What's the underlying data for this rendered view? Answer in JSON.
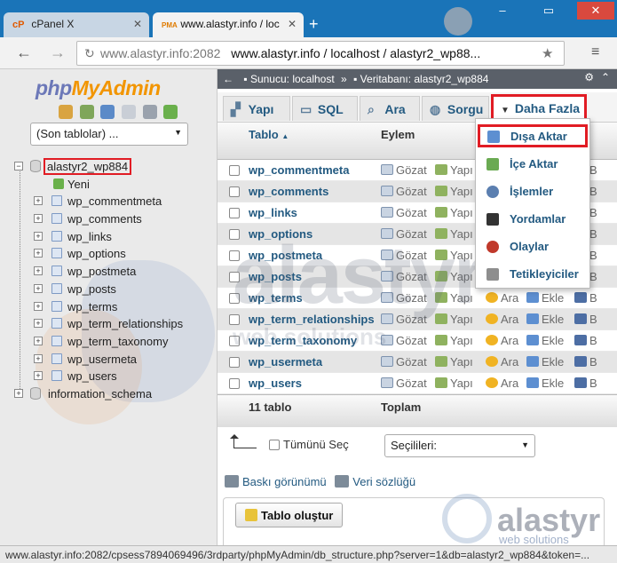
{
  "browser": {
    "tabs": [
      {
        "favicon": "cP",
        "title": "cPanel X"
      },
      {
        "favicon": "PMA",
        "title": "www.alastyr.info / loc"
      }
    ],
    "address": {
      "host": "www.alastyr.info:2082",
      "path": "www.alastyr.info / localhost / alastyr2_wp88..."
    },
    "status_url": "www.alastyr.info:2082/cpsess7894069496/3rdparty/phpMyAdmin/db_structure.php?server=1&db=alastyr2_wp884&token=..."
  },
  "sidebar": {
    "logo_php": "php",
    "logo_myadmin": "MyAdmin",
    "recent_select": "(Son tablolar) ...",
    "database": "alastyr2_wp884",
    "new_label": "Yeni",
    "tables": [
      "wp_commentmeta",
      "wp_comments",
      "wp_links",
      "wp_options",
      "wp_postmeta",
      "wp_posts",
      "wp_terms",
      "wp_term_relationships",
      "wp_term_taxonomy",
      "wp_usermeta",
      "wp_users"
    ],
    "other_db": "information_schema"
  },
  "breadcrumb": {
    "server_label": "Sunucu: localhost",
    "db_label": "Veritabanı: alastyr2_wp884"
  },
  "tabs": {
    "structure": "Yapı",
    "sql": "SQL",
    "search": "Ara",
    "query": "Sorgu",
    "more": "Daha Fazla"
  },
  "dropdown": {
    "export": "Dışa Aktar",
    "import": "İçe Aktar",
    "operations": "İşlemler",
    "routines": "Yordamlar",
    "events": "Olaylar",
    "triggers": "Tetikleyiciler"
  },
  "grid": {
    "col_table": "Tablo",
    "col_action": "Eylem",
    "action_browse": "Gözat",
    "action_structure": "Yapı",
    "action_search": "Ara",
    "action_insert": "Ekle",
    "action_empty": "B",
    "rows": [
      "wp_commentmeta",
      "wp_comments",
      "wp_links",
      "wp_options",
      "wp_postmeta",
      "wp_posts",
      "wp_terms",
      "wp_term_relationships",
      "wp_term_taxonomy",
      "wp_usermeta",
      "wp_users"
    ],
    "footer_count": "11 tablo",
    "footer_total": "Toplam"
  },
  "bulk": {
    "check_all": "Tümünü Seç",
    "with_selected": "Seçilileri:"
  },
  "links": {
    "print_view": "Baskı görünümü",
    "data_dictionary": "Veri sözlüğü"
  },
  "create_table": "Tablo oluştur",
  "watermark": {
    "brand": "alastyr",
    "sub": "web solutions"
  },
  "colors": {
    "highlight": "#e11c24",
    "link": "#235a81",
    "tabbar": "#1a74b8"
  }
}
